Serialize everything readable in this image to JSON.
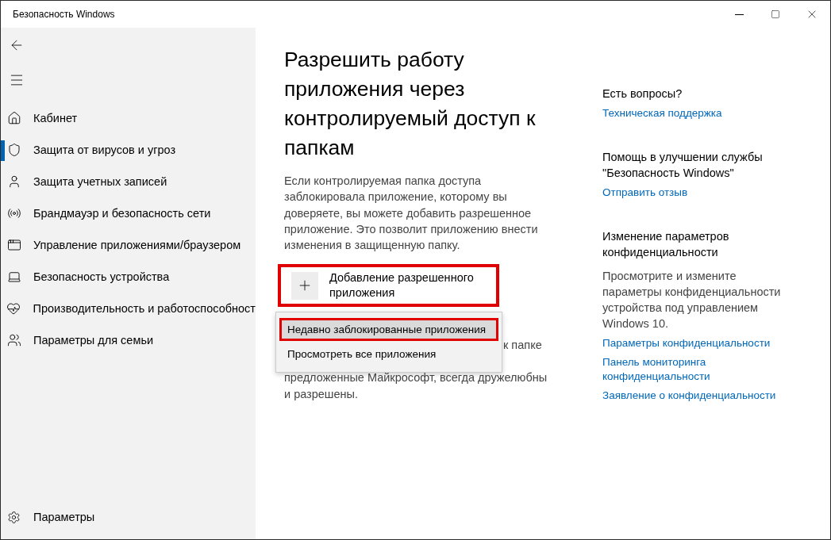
{
  "window": {
    "title": "Безопасность Windows"
  },
  "sidebar": {
    "items": [
      {
        "label": "Кабинет",
        "selected": false
      },
      {
        "label": "Защита от вирусов и угроз",
        "selected": true
      },
      {
        "label": "Защита учетных записей",
        "selected": false
      },
      {
        "label": "Брандмауэр и безопасность сети",
        "selected": false
      },
      {
        "label": "Управление приложениями/браузером",
        "selected": false
      },
      {
        "label": "Безопасность устройства",
        "selected": false
      },
      {
        "label": "Производительность и работоспособност",
        "selected": false
      },
      {
        "label": "Параметры для семьи",
        "selected": false
      }
    ],
    "footer": {
      "label": "Параметры"
    }
  },
  "main": {
    "heading": "Разрешить работу приложения через контролируемый доступ к папкам",
    "description": "Если контролируемая папка доступа заблокировала приложение, которому вы доверяете, вы можете добавить разрешенное приложение. Это позволит приложению внести изменения в защищенную папку.",
    "add_button": {
      "label": "Добавление разрешенного приложения",
      "highlighted": true
    },
    "menu": {
      "items": [
        {
          "label": "Недавно заблокированные приложения",
          "selected": true,
          "highlighted": true
        },
        {
          "label": "Просмотреть все приложения",
          "selected": false,
          "highlighted": false
        }
      ]
    },
    "note": {
      "visible_start": "к папке",
      "visible_end": "предложенные Майкрософт, всегда дружелюбны и разрешены."
    }
  },
  "aside": {
    "sections": [
      {
        "title": "Есть вопросы?",
        "links": [
          "Техническая поддержка"
        ]
      },
      {
        "title": "Помощь в улучшении службы \"Безопасность Windows\"",
        "links": [
          "Отправить отзыв"
        ]
      },
      {
        "title": "Изменение параметров конфиденциальности",
        "body": "Просмотрите и измените параметры конфиденциальности устройства под управлением Windows 10.",
        "links": [
          "Параметры конфиденциальности",
          "Панель мониторинга конфиденциальности",
          "Заявление о конфиденциальности"
        ]
      }
    ]
  }
}
